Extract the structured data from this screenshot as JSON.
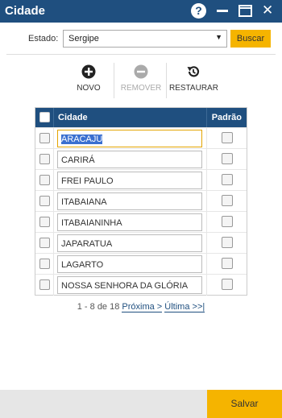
{
  "window": {
    "title": "Cidade",
    "help_glyph": "?",
    "close_glyph": "✕"
  },
  "filter": {
    "estado_label": "Estado:",
    "estado_value": "Sergipe",
    "buscar_label": "Buscar"
  },
  "toolbar": {
    "novo_label": "NOVO",
    "remover_label": "REMOVER",
    "restaurar_label": "RESTAURAR"
  },
  "grid": {
    "columns": {
      "cidade": "Cidade",
      "padrao": "Padrão"
    },
    "rows": [
      {
        "cidade": "ARACAJÚ"
      },
      {
        "cidade": "CARIRÁ"
      },
      {
        "cidade": "FREI PAULO"
      },
      {
        "cidade": "ITABAIANA"
      },
      {
        "cidade": "ITABAIANINHA"
      },
      {
        "cidade": "JAPARATUA"
      },
      {
        "cidade": "LAGARTO"
      },
      {
        "cidade": "NOSSA SENHORA DA GLÓRIA"
      }
    ]
  },
  "pager": {
    "summary": "1 - 8 de 18",
    "next_label": "Próxima >",
    "last_label": "Última >>|"
  },
  "footer": {
    "salvar_label": "Salvar"
  },
  "colors": {
    "header_bg": "#1f4f7f",
    "accent": "#f5b400"
  }
}
